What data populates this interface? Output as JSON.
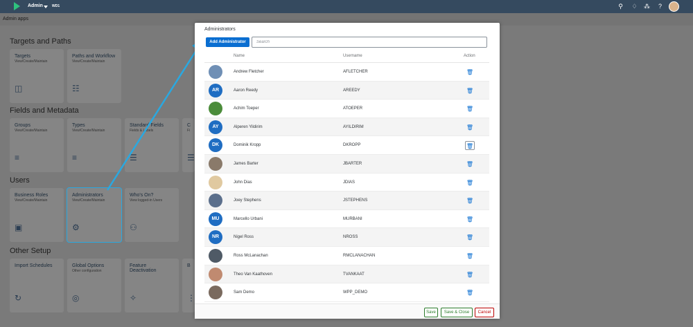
{
  "shell": {
    "title": "Admin",
    "subtitle": "WD1"
  },
  "subheader": {
    "label": "Admin apps"
  },
  "sections": {
    "targets": "Targets and Paths",
    "fields": "Fields and Metadata",
    "users": "Users",
    "other": "Other Setup"
  },
  "tiles": {
    "targets": {
      "title": "Targets",
      "sub": "View/Create/Maintain"
    },
    "paths": {
      "title": "Paths and Workflow",
      "sub": "View/Create/Maintain"
    },
    "groups": {
      "title": "Groups",
      "sub": "View/Create/Maintain"
    },
    "types": {
      "title": "Types",
      "sub": "View/Create/Maintain"
    },
    "standard": {
      "title": "Standard Fields",
      "sub": "Fields & Labels"
    },
    "c4": {
      "title": "C",
      "sub": "Fi"
    },
    "roles": {
      "title": "Business Roles",
      "sub": "View/Create/Maintain"
    },
    "admins": {
      "title": "Administrators",
      "sub": "View/Create/Maintain"
    },
    "whos": {
      "title": "Who's On?",
      "sub": "View logged-in Users"
    },
    "import": {
      "title": "Import Schedules",
      "sub": ""
    },
    "global": {
      "title": "Global Options",
      "sub": "Other configuration"
    },
    "feature": {
      "title": "Feature Deactivation",
      "sub": ""
    },
    "b4": {
      "title": "B",
      "sub": ""
    }
  },
  "dialog": {
    "title": "Administrators",
    "add_button": "Add Administrator",
    "search_placeholder": "Search",
    "columns": {
      "name": "Name",
      "username": "Username",
      "action": "Action"
    },
    "rows": [
      {
        "initials": "",
        "name": "Andrew Fletcher",
        "username": "AFLETCHER"
      },
      {
        "initials": "AR",
        "name": "Aaron Reedy",
        "username": "AREEDY"
      },
      {
        "initials": "",
        "name": "Achim Toeper",
        "username": "ATOEPER"
      },
      {
        "initials": "AY",
        "name": "Alperen Yildirim",
        "username": "AYILDIRIM"
      },
      {
        "initials": "DK",
        "name": "Dominik Kropp",
        "username": "DKROPP"
      },
      {
        "initials": "",
        "name": "James Barter",
        "username": "JBARTER"
      },
      {
        "initials": "",
        "name": "John Dias",
        "username": "JDIAS"
      },
      {
        "initials": "",
        "name": "Joey Stephens",
        "username": "JSTEPHENS"
      },
      {
        "initials": "MU",
        "name": "Marcello Urbani",
        "username": "MURBANI"
      },
      {
        "initials": "NR",
        "name": "Nigel Ross",
        "username": "NROSS"
      },
      {
        "initials": "",
        "name": "Ross McLanachan",
        "username": "RMCLANACHAN"
      },
      {
        "initials": "",
        "name": "Theo Van Kaathoven",
        "username": "TVANKAAT"
      },
      {
        "initials": "",
        "name": "Sam Demo",
        "username": "WPP_DEMO"
      }
    ],
    "footer": {
      "save": "Save",
      "save_close": "Save & Close",
      "cancel": "Cancel"
    }
  },
  "colors": {
    "shell": "#354a5f",
    "primary": "#0a6ed1",
    "accept": "#2b7c2b",
    "reject": "#bb0000",
    "highlight": "#2aa8e0"
  }
}
